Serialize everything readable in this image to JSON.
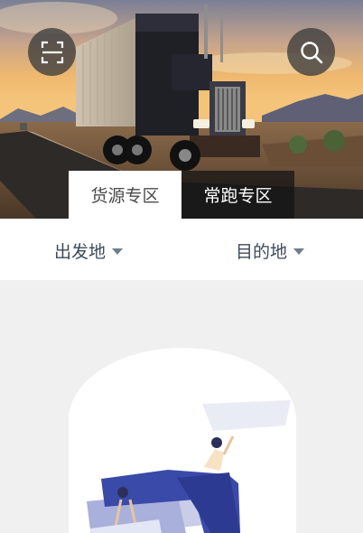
{
  "header": {
    "scan_icon": "scan-icon",
    "search_icon": "search-icon"
  },
  "tabs": [
    {
      "label": "货源专区",
      "active": true
    },
    {
      "label": "常跑专区",
      "active": false
    }
  ],
  "filters": {
    "origin_label": "出发地",
    "destination_label": "目的地"
  },
  "colors": {
    "accent_text": "#3c4a5a",
    "content_bg": "#f0f0f0",
    "illustration_blue": "#3a4aa8"
  }
}
